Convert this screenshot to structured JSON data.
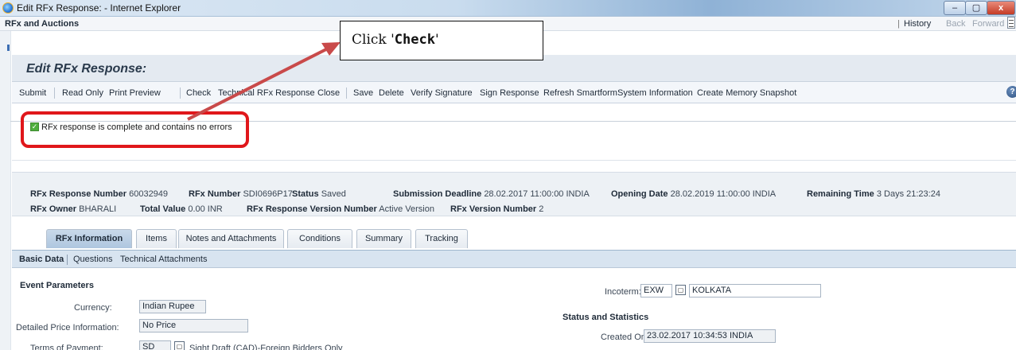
{
  "window": {
    "title": "Edit RFx Response: - Internet Explorer",
    "min": "–",
    "max": "▢",
    "close": "x"
  },
  "app": {
    "title": "RFx and Auctions",
    "sep": "|",
    "history": "History",
    "back": "Back",
    "forward": "Forward"
  },
  "page": {
    "title": "Edit RFx Response:"
  },
  "toolbar": {
    "submit": "Submit",
    "read_only": "Read Only",
    "print_preview": "Print Preview",
    "check": "Check",
    "technical_response": "Technical RFx Response",
    "close": "Close",
    "save": "Save",
    "delete": "Delete",
    "verify_signature": "Verify Signature",
    "sign_response": "Sign Response",
    "refresh_smartform": "Refresh Smartform",
    "system_information": "System Information",
    "create_memory_snapshot": "Create Memory Snapshot"
  },
  "message": {
    "text": "RFx response is complete and contains no errors"
  },
  "details": {
    "response_number_label": "RFx Response Number",
    "response_number": "60032949",
    "rfx_number_label": "RFx Number",
    "rfx_number": "SDI0696P17",
    "status_label": "Status",
    "status": "Saved",
    "deadline_label": "Submission Deadline",
    "deadline": "28.02.2017 11:00:00 INDIA",
    "opening_label": "Opening Date",
    "opening": "28.02.2019 11:00:00 INDIA",
    "remaining_label": "Remaining Time",
    "remaining": "3 Days 21:23:24",
    "owner_label": "RFx Owner",
    "owner": "BHARALI",
    "total_label": "Total Value",
    "total": "0.00 INR",
    "version_label": "RFx Response Version Number",
    "version": "Active Version",
    "rfx_version_label": "RFx Version Number",
    "rfx_version": "2"
  },
  "tabs": [
    "RFx Information",
    "Items",
    "Notes and Attachments",
    "Conditions",
    "Summary",
    "Tracking"
  ],
  "subtabs": [
    "Basic Data",
    "Questions",
    "Technical Attachments"
  ],
  "form": {
    "event_parameters": "Event Parameters",
    "currency_label": "Currency:",
    "currency": "Indian Rupee",
    "price_info_label": "Detailed Price Information:",
    "price_info": "No Price",
    "terms_label": "Terms of Payment:",
    "terms_code": "SD",
    "terms_text": "Sight Draft (CAD)-Foreign Bidders Only",
    "incoterm_label": "Incoterm:",
    "incoterm_code": "EXW",
    "incoterm_location": "KOLKATA",
    "status_stats": "Status and Statistics",
    "created_on_label": "Created On:",
    "created_on": "23.02.2017 10:34:53 INDIA"
  },
  "callout": {
    "prefix": "Click '",
    "keyword": "Check",
    "suffix": "'"
  },
  "colors": {
    "highlight": "#e0171b",
    "arrow": "#c94a4a",
    "tab_active": "#aec6df"
  }
}
